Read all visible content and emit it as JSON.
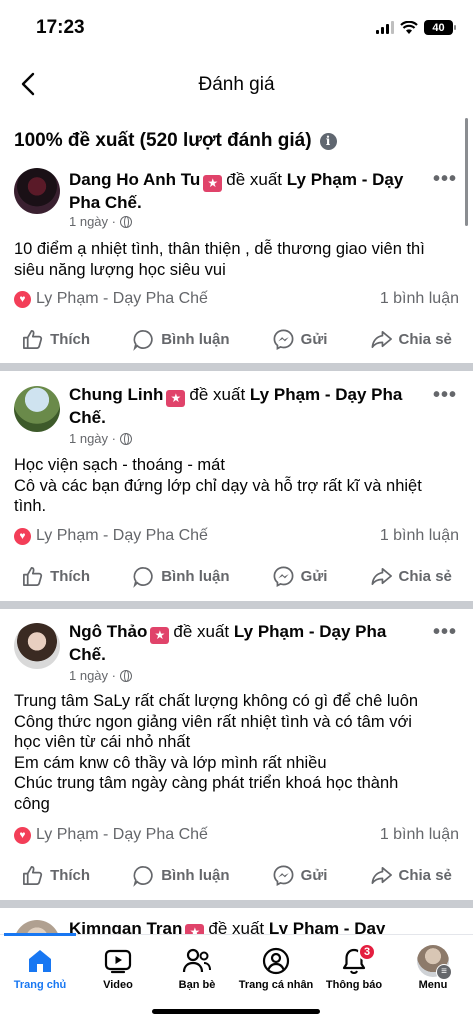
{
  "status": {
    "time": "17:23",
    "battery": "40"
  },
  "header": {
    "title": "Đánh giá",
    "back_icon": "chevron-left-icon"
  },
  "summary": {
    "text": "100% đề xuất (520 lượt đánh giá)",
    "info_icon": "i"
  },
  "actions": {
    "like": "Thích",
    "comment": "Bình luận",
    "send": "Gửi",
    "share": "Chia sẻ"
  },
  "posts": [
    {
      "author": "Dang Ho Anh Tu",
      "recommends": "đề xuất",
      "page": "Ly Phạm - Dạy Pha Chế.",
      "time": "1 ngày ·",
      "text": "10 điểm ạ nhiệt tình, thân thiện , dễ thương giao viên thì\nsiêu năng lượng học siêu vui",
      "reaction_label": "Ly Phạm - Dạy Pha Chế",
      "comments": "1 bình luận"
    },
    {
      "author": "Chung Linh",
      "recommends": "đề xuất",
      "page": "Ly Phạm - Dạy Pha Chế.",
      "time": "1 ngày ·",
      "text": "Học viện sạch - thoáng - mát\nCô và các bạn đứng lớp chỉ dạy và hỗ trợ rất kĩ và nhiệt\ntình.",
      "reaction_label": "Ly Phạm - Dạy Pha Chế",
      "comments": "1 bình luận"
    },
    {
      "author": "Ngô Thảo",
      "recommends": "đề xuất",
      "page": "Ly Phạm - Dạy Pha Chế.",
      "time": "1 ngày ·",
      "text": "Trung tâm SaLy rất chất lượng không có gì để chê luôn\nCông thức ngon giảng viên rất nhiệt tình và có tâm với\nhọc viên từ cái nhỏ nhất\nEm cám knw cô thầy và lớp mình rất nhiều\nChúc trung tâm ngày càng phát triển khoá học thành\ncông",
      "reaction_label": "Ly Phạm - Dạy Pha Chế",
      "comments": "1 bình luận"
    },
    {
      "author": "Kimngan Tran",
      "recommends": "đề xuất",
      "page": "Ly Phạm - Dạy"
    }
  ],
  "tabs": [
    {
      "label": "Trang chủ",
      "icon": "home-icon",
      "active": true
    },
    {
      "label": "Video",
      "icon": "video-icon"
    },
    {
      "label": "Bạn bè",
      "icon": "friends-icon"
    },
    {
      "label": "Trang cá nhân",
      "icon": "profile-icon"
    },
    {
      "label": "Thông báo",
      "icon": "bell-icon",
      "badge": "3"
    },
    {
      "label": "Menu",
      "icon": "menu-avatar-icon"
    }
  ],
  "colors": {
    "accent": "#1877f2",
    "badge": "#e0436a",
    "heart": "#f33e58",
    "notification": "#e41e3f"
  }
}
